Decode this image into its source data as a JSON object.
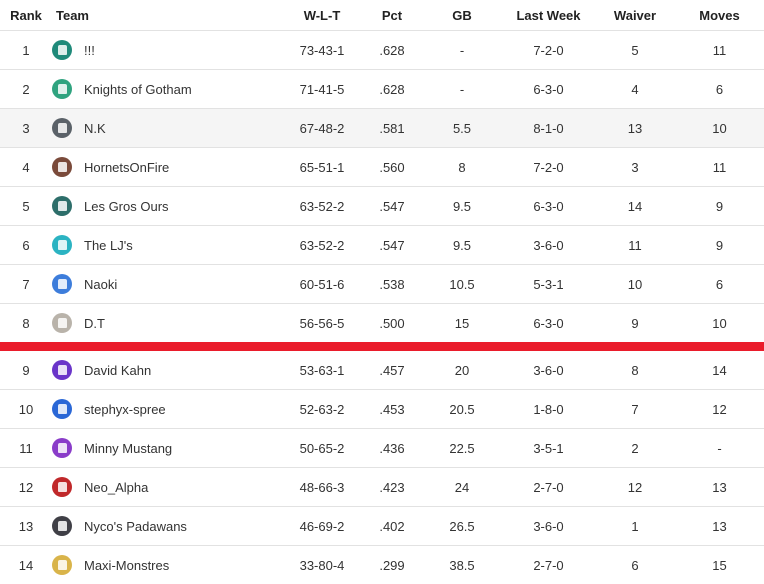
{
  "headers": {
    "rank": "Rank",
    "team": "Team",
    "wlt": "W-L-T",
    "pct": "Pct",
    "gb": "GB",
    "last_week": "Last Week",
    "waiver": "Waiver",
    "moves": "Moves"
  },
  "rows": [
    {
      "rank": "1",
      "team": "!!!",
      "wlt": "73-43-1",
      "pct": ".628",
      "gb": "-",
      "last_week": "7-2-0",
      "waiver": "5",
      "moves": "11",
      "logo_bg": "#1f8a7a",
      "logo_icon": "jersey-icon"
    },
    {
      "rank": "2",
      "team": "Knights of Gotham",
      "wlt": "71-41-5",
      "pct": ".628",
      "gb": "-",
      "last_week": "6-3-0",
      "waiver": "4",
      "moves": "6",
      "logo_bg": "#2fa37f",
      "logo_icon": "jersey-icon"
    },
    {
      "rank": "3",
      "team": "N.K",
      "wlt": "67-48-2",
      "pct": ".581",
      "gb": "5.5",
      "last_week": "8-1-0",
      "waiver": "13",
      "moves": "10",
      "logo_bg": "#5a6168",
      "logo_icon": "jersey-icon"
    },
    {
      "rank": "4",
      "team": "HornetsOnFire",
      "wlt": "65-51-1",
      "pct": ".560",
      "gb": "8",
      "last_week": "7-2-0",
      "waiver": "3",
      "moves": "11",
      "logo_bg": "#7a4a3a",
      "logo_icon": "hornet-icon"
    },
    {
      "rank": "5",
      "team": "Les Gros Ours",
      "wlt": "63-52-2",
      "pct": ".547",
      "gb": "9.5",
      "last_week": "6-3-0",
      "waiver": "14",
      "moves": "9",
      "logo_bg": "#2d6e6a",
      "logo_icon": "bear-icon"
    },
    {
      "rank": "6",
      "team": "The LJ's",
      "wlt": "63-52-2",
      "pct": ".547",
      "gb": "9.5",
      "last_week": "3-6-0",
      "waiver": "11",
      "moves": "9",
      "logo_bg": "#2bb3c2",
      "logo_icon": "jersey-icon"
    },
    {
      "rank": "7",
      "team": "Naoki",
      "wlt": "60-51-6",
      "pct": ".538",
      "gb": "10.5",
      "last_week": "5-3-1",
      "waiver": "10",
      "moves": "6",
      "logo_bg": "#3d7ddb",
      "logo_icon": "jersey-icon"
    },
    {
      "rank": "8",
      "team": "D.T",
      "wlt": "56-56-5",
      "pct": ".500",
      "gb": "15",
      "last_week": "6-3-0",
      "waiver": "9",
      "moves": "10",
      "logo_bg": "#b9b3aa",
      "logo_icon": "photo-icon"
    },
    {
      "rank": "9",
      "team": "David Kahn",
      "wlt": "53-63-1",
      "pct": ".457",
      "gb": "20",
      "last_week": "3-6-0",
      "waiver": "8",
      "moves": "14",
      "logo_bg": "#6a35c9",
      "logo_icon": "jersey-icon"
    },
    {
      "rank": "10",
      "team": "stephyx-spree",
      "wlt": "52-63-2",
      "pct": ".453",
      "gb": "20.5",
      "last_week": "1-8-0",
      "waiver": "7",
      "moves": "12",
      "logo_bg": "#2a67d6",
      "logo_icon": "jersey-icon"
    },
    {
      "rank": "11",
      "team": "Minny Mustang",
      "wlt": "50-65-2",
      "pct": ".436",
      "gb": "22.5",
      "last_week": "3-5-1",
      "waiver": "2",
      "moves": "-",
      "logo_bg": "#8a3cc9",
      "logo_icon": "jersey-icon"
    },
    {
      "rank": "12",
      "team": "Neo_Alpha",
      "wlt": "48-66-3",
      "pct": ".423",
      "gb": "24",
      "last_week": "2-7-0",
      "waiver": "12",
      "moves": "13",
      "logo_bg": "#c0282a",
      "logo_icon": "phoenix-icon"
    },
    {
      "rank": "13",
      "team": "Nyco's Padawans",
      "wlt": "46-69-2",
      "pct": ".402",
      "gb": "26.5",
      "last_week": "3-6-0",
      "waiver": "1",
      "moves": "13",
      "logo_bg": "#3f3f46",
      "logo_icon": "figure-icon"
    },
    {
      "rank": "14",
      "team": "Maxi-Monstres",
      "wlt": "33-80-4",
      "pct": ".299",
      "gb": "38.5",
      "last_week": "2-7-0",
      "waiver": "6",
      "moves": "15",
      "logo_bg": "#d9b44a",
      "logo_icon": "monster-icon"
    }
  ],
  "colors": {
    "cutline": "#ea1c2b",
    "shaded_row": "#f5f5f5"
  }
}
